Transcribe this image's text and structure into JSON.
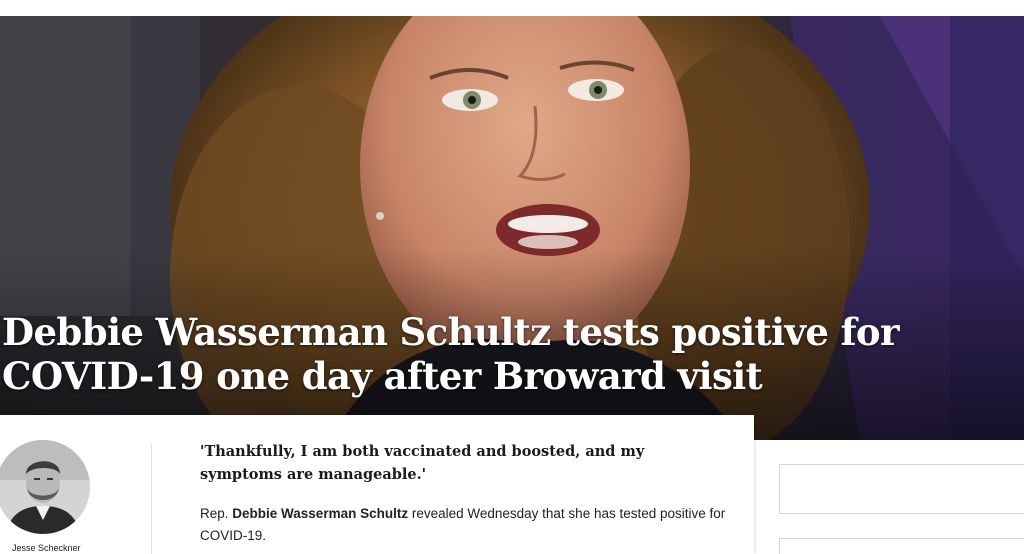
{
  "article": {
    "headline": "Debbie Wasserman Schultz tests positive for COVID-19 one day after Broward visit",
    "dek": "'Thankfully, I am both vaccinated and boosted, and my symptoms are manageable.'",
    "lede": {
      "prefix": "Rep. ",
      "subject": "Debbie Wasserman Schultz",
      "rest": " revealed Wednesday that she has tested positive for COVID-19."
    },
    "author": {
      "name": "Jesse Scheckner"
    }
  },
  "colors": {
    "headline_text": "#ffffff",
    "hero_background": "#2a2328",
    "accent_purple": "#4a2a6e"
  }
}
